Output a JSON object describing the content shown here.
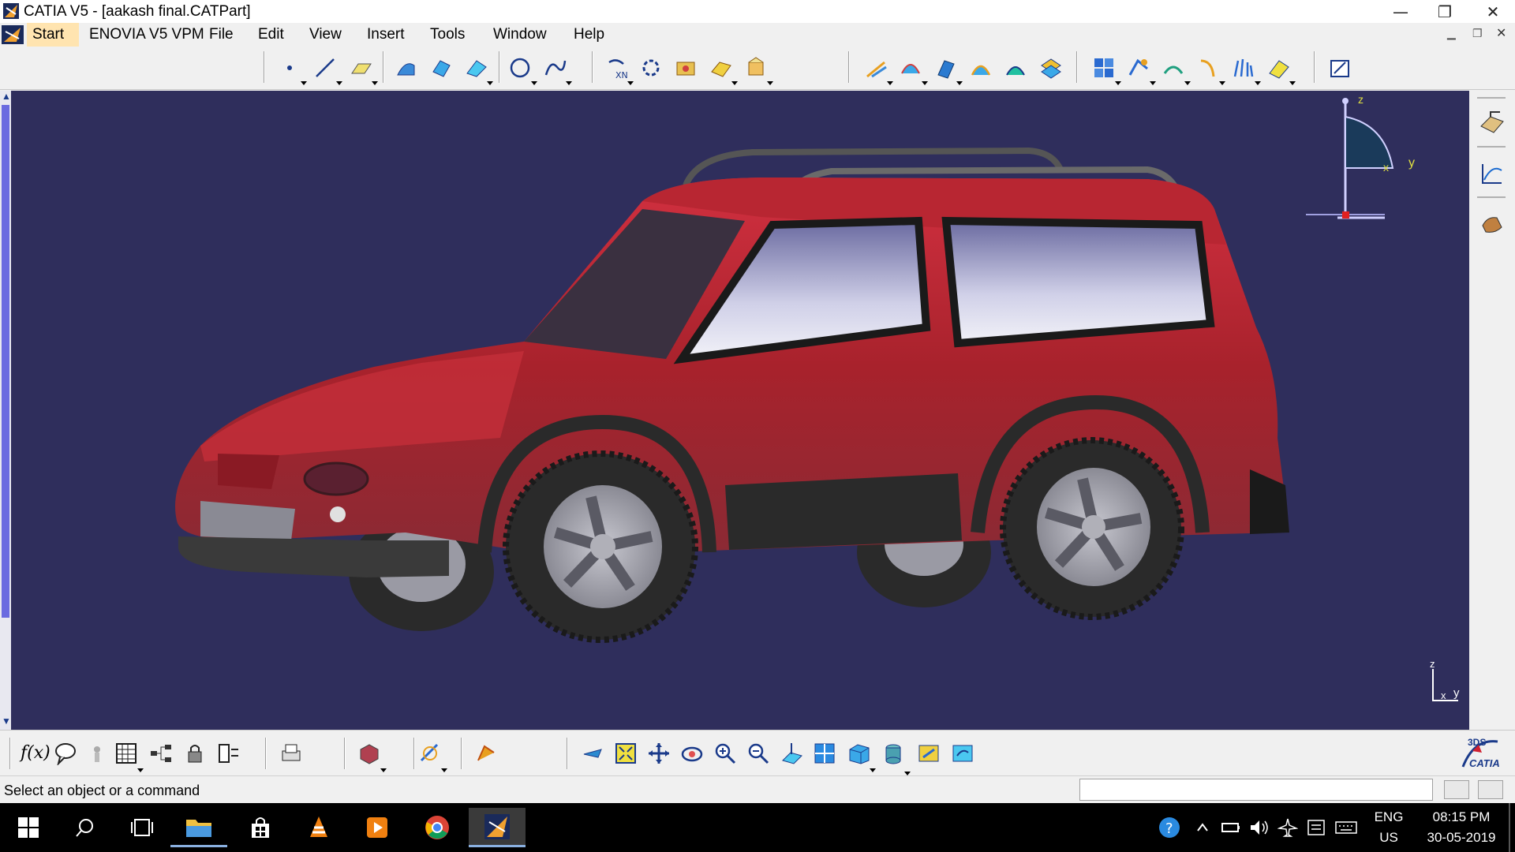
{
  "window": {
    "title": "CATIA V5 - [aakash final.CATPart]",
    "minimize_glyph": "—",
    "restore_glyph": "❐",
    "close_glyph": "✕"
  },
  "menu": {
    "items": [
      "Start",
      "ENOVIA V5 VPM",
      "File",
      "Edit",
      "View",
      "Insert",
      "Tools",
      "Window",
      "Help"
    ]
  },
  "compass": {
    "z_label": "z",
    "x_label": "x",
    "y_label": "y"
  },
  "axis_triad": {
    "z_label": "z",
    "x_label": "x",
    "y_label": "y"
  },
  "bottom_toolbar": {
    "formula_label": "f(x)"
  },
  "brand": {
    "logo_text": "CATIA",
    "logo_mark": "3DS"
  },
  "status": {
    "message": "Select an object or a command",
    "command_value": ""
  },
  "taskbar": {
    "language": "ENG",
    "region": "US",
    "time": "08:15 PM",
    "date": "30-05-2019"
  },
  "colors": {
    "viewport_background": "#2f2e5c",
    "car_body": "#b0222c",
    "tire": "#2a2a2a",
    "rim": "#a9a9b0"
  }
}
